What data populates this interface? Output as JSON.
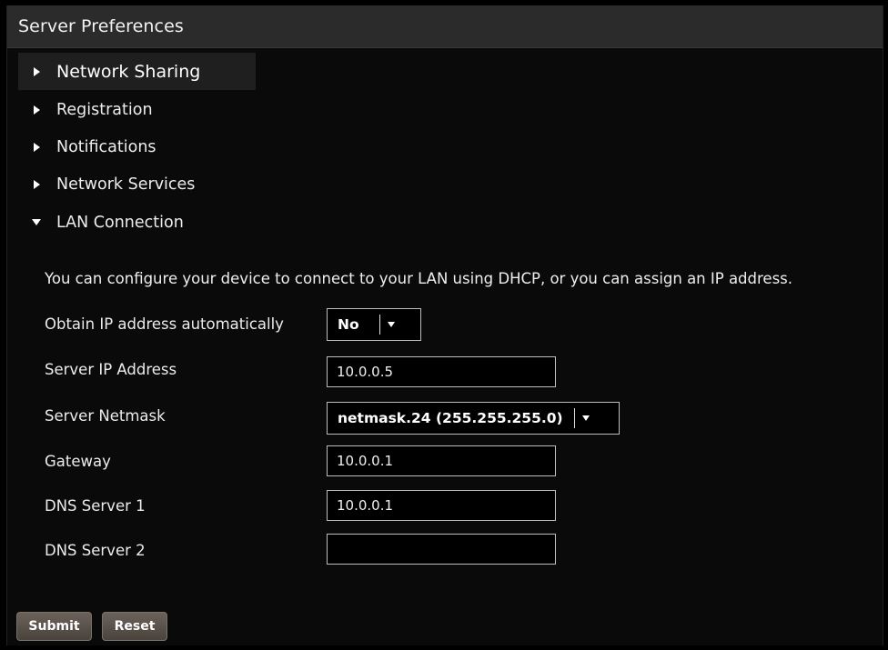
{
  "window": {
    "title": "Server Preferences"
  },
  "menu": {
    "items": [
      {
        "label": "Network Sharing",
        "state": "collapsed",
        "active": true
      },
      {
        "label": "Registration",
        "state": "collapsed",
        "active": false
      },
      {
        "label": "Notifications",
        "state": "collapsed",
        "active": false
      },
      {
        "label": "Network Services",
        "state": "collapsed",
        "active": false
      },
      {
        "label": "LAN Connection",
        "state": "expanded",
        "active": false
      }
    ]
  },
  "lan": {
    "description": "You can configure your device to connect to your LAN using DHCP, or you can assign an IP address.",
    "obtain_ip": {
      "label": "Obtain IP address automatically",
      "value": "No"
    },
    "server_ip": {
      "label": "Server IP Address",
      "value": "10.0.0.5"
    },
    "netmask": {
      "label": "Server Netmask",
      "value": "netmask.24 (255.255.255.0)"
    },
    "gateway": {
      "label": "Gateway",
      "value": "10.0.0.1"
    },
    "dns1": {
      "label": "DNS Server 1",
      "value": "10.0.0.1"
    },
    "dns2": {
      "label": "DNS Server 2",
      "value": ""
    }
  },
  "buttons": {
    "submit": "Submit",
    "reset": "Reset"
  },
  "icons": {
    "collapsed": "triangle-right-icon",
    "expanded": "triangle-down-icon",
    "dropdown": "caret-down-icon"
  },
  "colors": {
    "background": "#000000",
    "title_bar": "#2b2b2b",
    "active_item": "#1f1f1f",
    "input_border": "#bdbdbd",
    "button": "#5a524b"
  }
}
